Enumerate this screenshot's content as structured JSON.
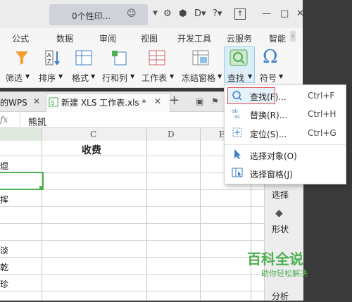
{
  "titlebar": {
    "tab_title": "0个性印...",
    "controls": [
      "⌘",
      "⇩",
      "D-",
      "?-",
      "↑",
      "—",
      "□",
      "✕"
    ]
  },
  "ribbon_tabs": [
    "公式",
    "数据",
    "审阅",
    "视图",
    "开发工具",
    "云服务",
    "智能"
  ],
  "ribbon_buttons": {
    "filter": "筛选",
    "sort": "排序",
    "format": "格式",
    "rowcol": "行和列",
    "sheet": "工作表",
    "freeze": "冻结窗格",
    "find": "查找",
    "symbol": "符号"
  },
  "doc_tabs": {
    "left_tab": "的WPS",
    "active_tab": "新建 XLS 工作表.xls *",
    "add": "+"
  },
  "formula_bar": {
    "fx": "fx",
    "value": "熊凯"
  },
  "columns": [
    "C",
    "D",
    "E"
  ],
  "sheet": {
    "header_c": "收费",
    "col_a_fragments": [
      "焜",
      "",
      "挥",
      "",
      "",
      "淡",
      "乾",
      "珍"
    ]
  },
  "side_panel": {
    "select": "选择",
    "shape": "形状",
    "analyze": "分析"
  },
  "dropdown": {
    "items": [
      {
        "label": "查找(F)...",
        "shortcut": "Ctrl+F"
      },
      {
        "label": "替换(R)...",
        "shortcut": "Ctrl+H"
      },
      {
        "label": "定位(S)...",
        "shortcut": "Ctrl+G"
      },
      {
        "label": "选择对象(O)",
        "shortcut": ""
      },
      {
        "label": "选择窗格(J)",
        "shortcut": ""
      }
    ]
  },
  "watermark": {
    "title": "百科全说",
    "subtitle": "助你轻松解决"
  },
  "colors": {
    "accent_green": "#4caf50",
    "highlight_red": "#e04848",
    "find_button_bg": "#dbeef7"
  }
}
